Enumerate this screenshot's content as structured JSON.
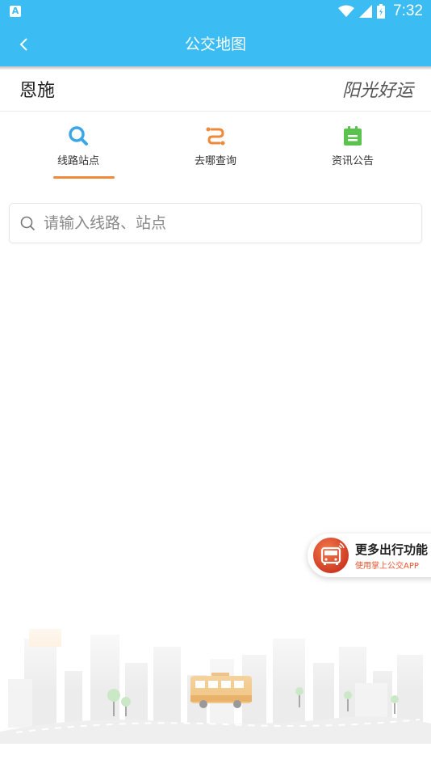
{
  "status_bar": {
    "app_badge": "A",
    "time": "7:32"
  },
  "header": {
    "title": "公交地图",
    "back_icon": "chevron-left-icon"
  },
  "city": {
    "name": "恩施",
    "slogan": "阳光好运"
  },
  "tabs": [
    {
      "label": "线路站点",
      "icon": "search-icon",
      "active": true,
      "color": "#3ba6e8"
    },
    {
      "label": "去哪查询",
      "icon": "route-icon",
      "active": false,
      "color": "#f08a3b"
    },
    {
      "label": "资讯公告",
      "icon": "notice-icon",
      "active": false,
      "color": "#5cc24e"
    }
  ],
  "search": {
    "placeholder": "请输入线路、站点",
    "value": ""
  },
  "promo": {
    "title": "更多出行功能",
    "subtitle": "使用掌上公交APP"
  },
  "colors": {
    "primary": "#3bbcf3",
    "accent": "#f08a3b",
    "promo_red": "#e8542c"
  }
}
